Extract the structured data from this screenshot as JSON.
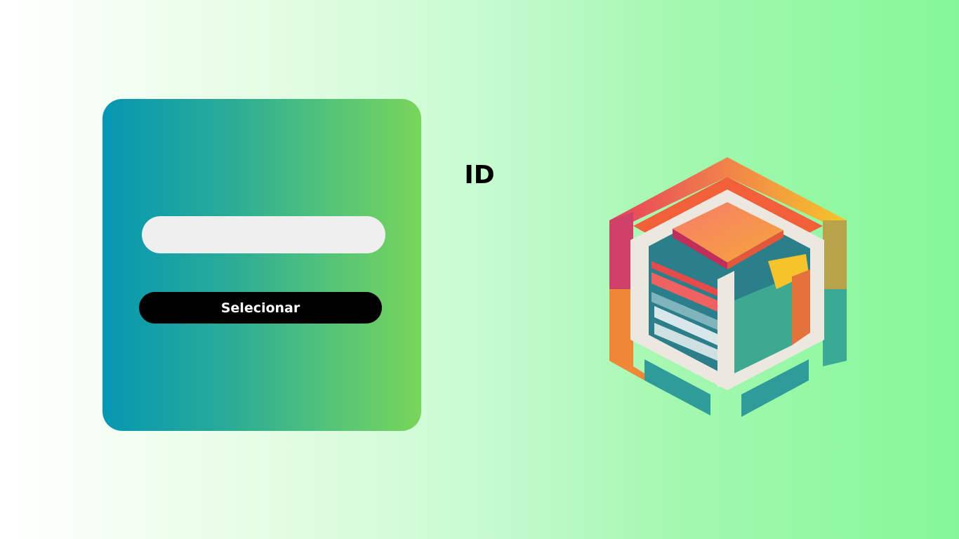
{
  "form": {
    "title": "ID",
    "input_value": "",
    "input_placeholder": "",
    "button_label": "Selecionar"
  },
  "logo": {
    "icon": "cube-logo-icon"
  },
  "colors": {
    "card_gradient_start": "#0597b3",
    "card_gradient_end": "#79d55a",
    "background_gradient_start": "#ffffff",
    "background_gradient_end": "#84f898",
    "input_background": "#efefef",
    "button_background": "#000000",
    "button_text": "#ffffff"
  }
}
